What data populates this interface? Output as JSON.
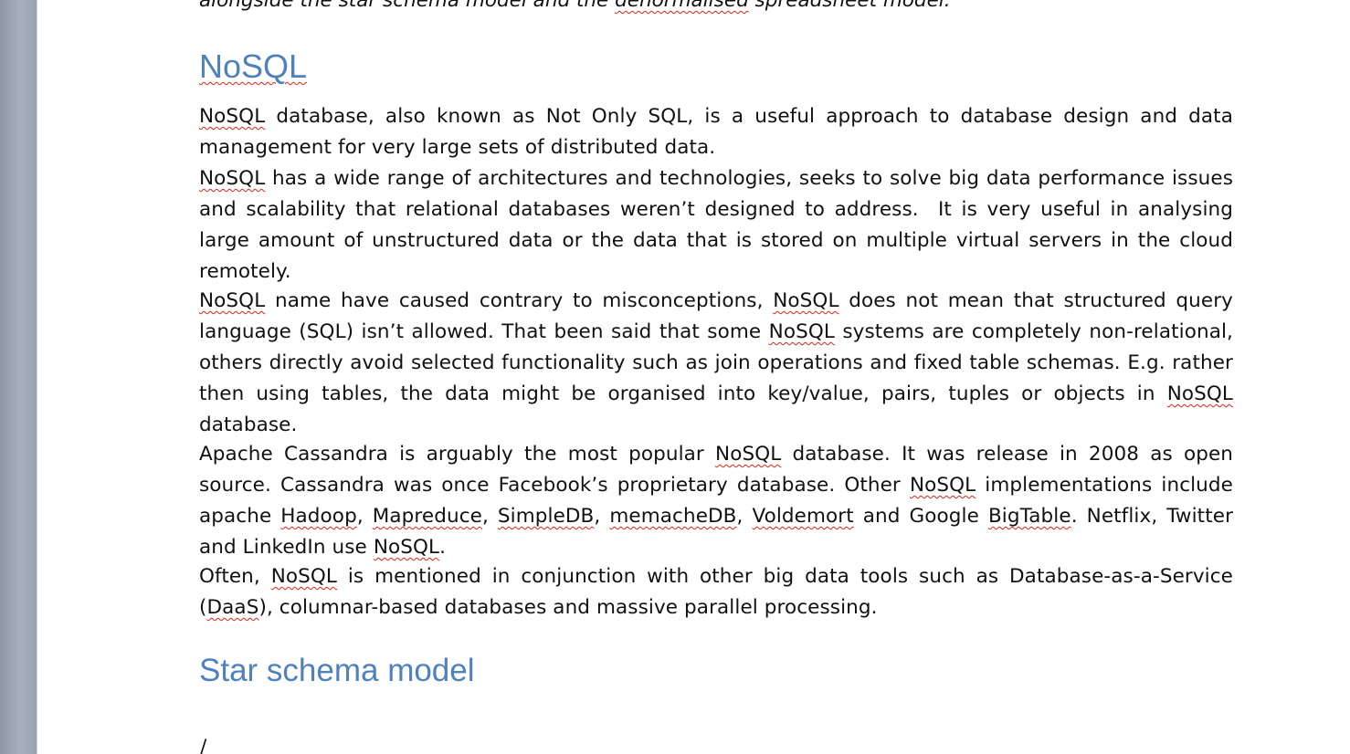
{
  "document": {
    "previous_line": "alongside the star schema model and the denormalised spreadsheet model.",
    "heading_nosql": "NoSQL",
    "paragraphs": [
      "NoSQL database, also known as Not Only SQL, is a useful approach to database design and data management for very large sets of distributed data.",
      "NoSQL has a wide range of architectures and technologies, seeks to solve big data performance issues and scalability that relational databases weren’t designed to address.  It is very useful in analysing large amount of unstructured data or the data that is stored on multiple virtual servers in the cloud remotely.",
      "NoSQL name have caused contrary to misconceptions, NoSQL does not mean that structured query language (SQL) isn’t allowed. That been said that some NoSQL systems are completely non-relational, others directly avoid selected functionality such as join operations and fixed table schemas. E.g. rather then using tables, the data might be organised into key/value, pairs, tuples or objects in NoSQL database.",
      "Apache Cassandra is arguably the most popular NoSQL database. It was release in 2008 as open source. Cassandra was once Facebook’s proprietary database. Other NoSQL implementations include apache Hadoop, Mapreduce, SimpleDB, memacheDB, Voldemort and Google BigTable. Netflix, Twitter and LinkedIn use NoSQL.",
      "Often, NoSQL is mentioned in conjunction with other big data tools such as Database-as-a-Service (DaaS), columnar-based databases and massive parallel processing."
    ],
    "heading_star": "Star schema model",
    "next_line_start": "/"
  },
  "spellcheck_flagged_words": [
    "NoSQL",
    "denormalised",
    "Hadoop",
    "Mapreduce",
    "SimpleDB",
    "memacheDB",
    "Voldemort",
    "BigTable",
    "DaaS"
  ],
  "colors": {
    "heading": "#4f81bd",
    "spellcheck_underline": "#e0241b",
    "gutter": "#a8afbc",
    "text": "#111111"
  }
}
